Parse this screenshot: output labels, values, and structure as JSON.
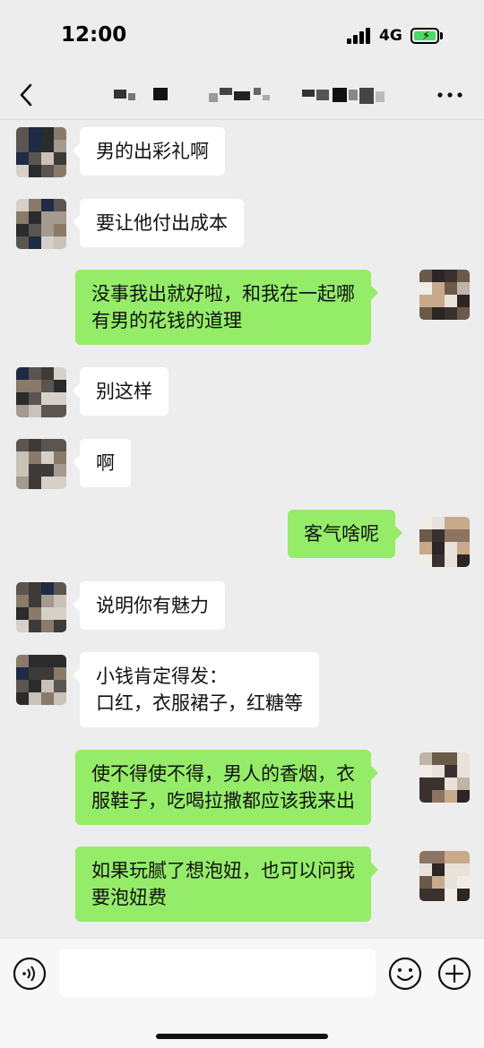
{
  "status_bar": {
    "time": "12:00",
    "network": "4G",
    "battery_level": 1.0,
    "battery_color": "#4cd964"
  },
  "nav": {
    "back_icon": "chevron-left-icon",
    "more_icon": "more-horizontal-icon",
    "title_obscured": true
  },
  "colors": {
    "background": "#ededed",
    "incoming_bubble": "#ffffff",
    "outgoing_bubble": "#95ec69"
  },
  "messages": [
    {
      "side": "left",
      "lines": [
        "男的出彩礼啊"
      ]
    },
    {
      "side": "left",
      "lines": [
        "要让他付出成本"
      ]
    },
    {
      "side": "right",
      "lines": [
        "没事我出就好啦，和我在一起哪",
        "有男的花钱的道理"
      ]
    },
    {
      "side": "left",
      "lines": [
        "别这样"
      ]
    },
    {
      "side": "left",
      "lines": [
        "啊"
      ]
    },
    {
      "side": "right",
      "lines": [
        "客气啥呢"
      ]
    },
    {
      "side": "left",
      "lines": [
        "说明你有魅力"
      ]
    },
    {
      "side": "left",
      "lines": [
        "小钱肯定得发：",
        "口红，衣服裙子，红糖等"
      ]
    },
    {
      "side": "right",
      "lines": [
        "使不得使不得，男人的香烟，衣",
        "服鞋子，吃喝拉撒都应该我来出"
      ]
    },
    {
      "side": "right",
      "lines": [
        "如果玩腻了想泡妞，也可以问我",
        "要泡妞费"
      ]
    }
  ],
  "input_bar": {
    "voice_icon": "voice-icon",
    "emoji_icon": "emoji-icon",
    "plus_icon": "plus-icon",
    "text_value": "",
    "placeholder": ""
  }
}
